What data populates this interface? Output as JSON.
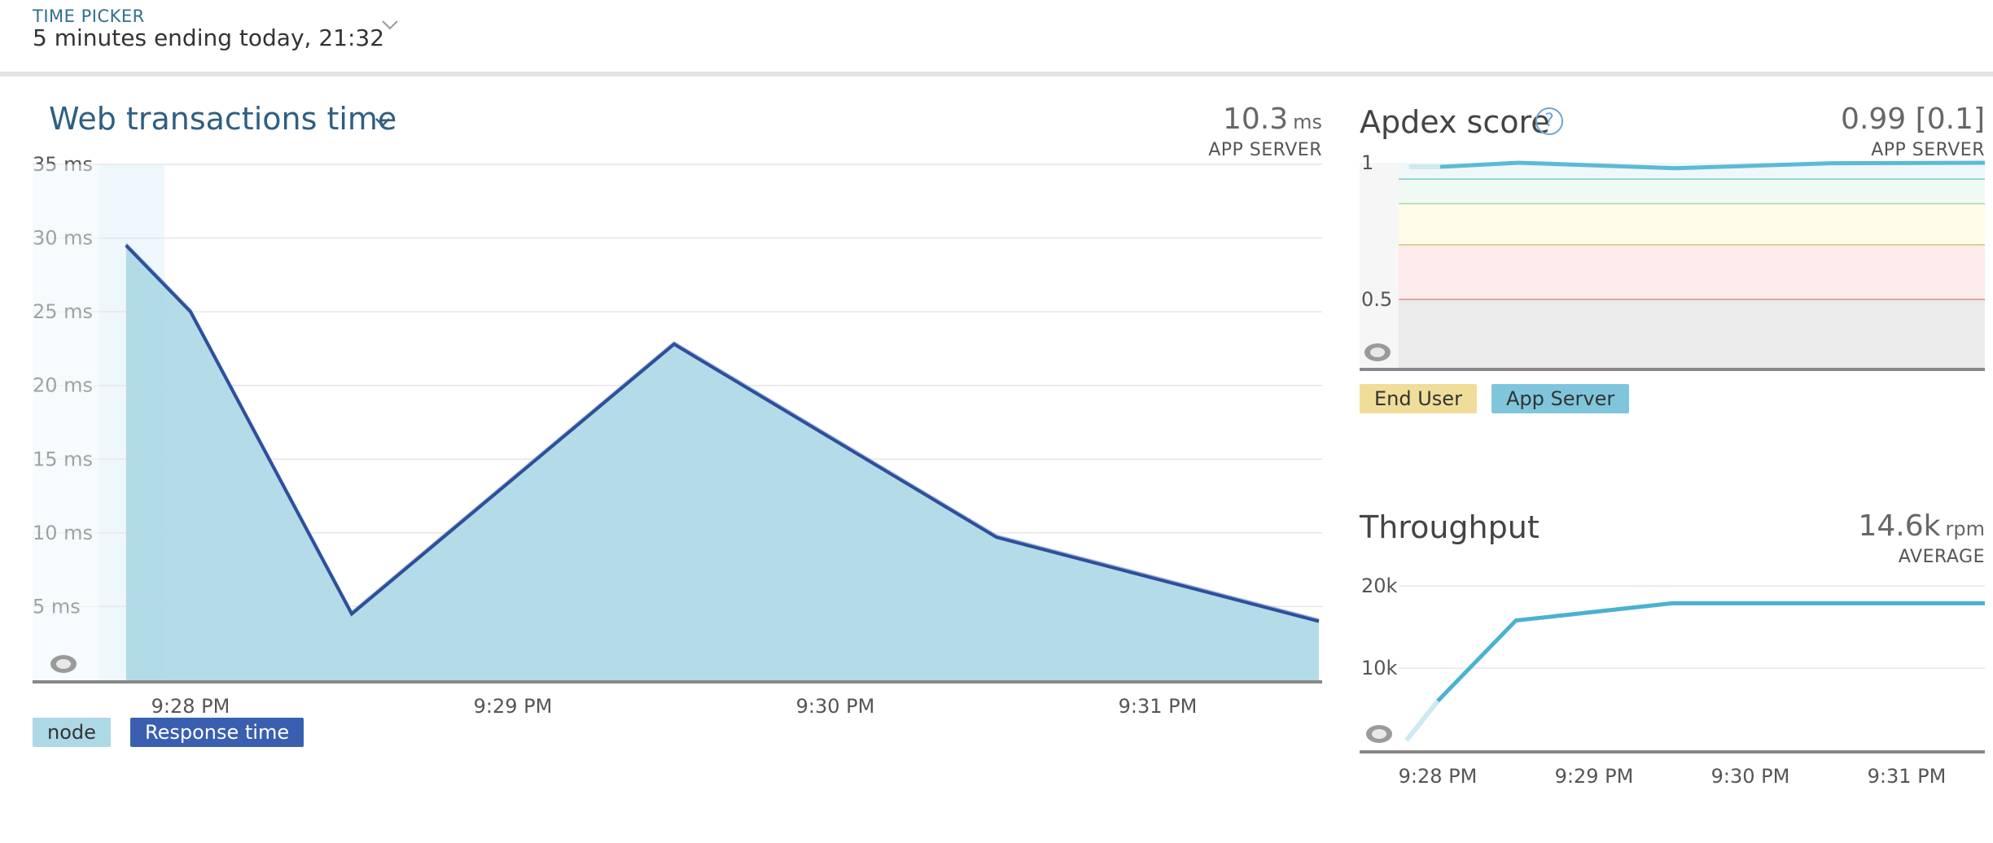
{
  "time_picker": {
    "label": "TIME PICKER",
    "value": "5 minutes ending today, 21:32",
    "icon": "chevron-down-icon"
  },
  "web_panel": {
    "title": "Web transactions time",
    "value": "10.3",
    "unit": "ms",
    "sublabel": "APP SERVER",
    "legend": [
      {
        "label": "node",
        "color": "#add8e6"
      },
      {
        "label": "Response time",
        "color": "#3a5fb0"
      }
    ]
  },
  "apdex_panel": {
    "title": "Apdex score",
    "value": "0.99 [0.1]",
    "sublabel": "APP SERVER",
    "legend": [
      {
        "label": "End User",
        "color": "#f0dd99"
      },
      {
        "label": "App Server",
        "color": "#7fc6dc"
      }
    ]
  },
  "throughput_panel": {
    "title": "Throughput",
    "value": "14.6k",
    "unit": "rpm",
    "sublabel": "AVERAGE"
  },
  "chart_data": [
    {
      "type": "area",
      "title": "Web transactions time",
      "ylim": [
        0,
        35
      ],
      "ytick_labels": [
        "5 ms",
        "10 ms",
        "15 ms",
        "20 ms",
        "25 ms",
        "30 ms",
        "35 ms"
      ],
      "ytick_values": [
        5,
        10,
        15,
        20,
        25,
        30,
        35
      ],
      "xtick_labels": [
        "9:28 PM",
        "9:29 PM",
        "9:30 PM",
        "9:31 PM"
      ],
      "xtick_minutes": [
        0,
        1,
        2,
        3
      ],
      "x_minutes": [
        -0.2,
        0,
        0.5,
        1.5,
        2.5,
        3.5
      ],
      "series": [
        {
          "name": "node",
          "values": [
            29.5,
            25,
            4.5,
            22.8,
            9.7,
            4
          ],
          "color": "#add8e6"
        },
        {
          "name": "Response time",
          "values": [
            29.5,
            25,
            4.5,
            22.8,
            9.7,
            4
          ],
          "color": "#2d4f9c"
        }
      ],
      "grid": true
    },
    {
      "type": "line",
      "title": "Apdex score",
      "ylim": [
        0,
        1
      ],
      "ytick_labels": [
        "0.5",
        "1"
      ],
      "ytick_values": [
        0.5,
        1
      ],
      "x_minutes": [
        -0.2,
        0,
        0.5,
        1.5,
        2.5,
        3.5
      ],
      "series": [
        {
          "name": "App Server",
          "values": [
            0.985,
            0.985,
            1.0,
            0.98,
            0.998,
            1.0
          ],
          "color": "#5bbad5"
        }
      ],
      "bands": [
        {
          "from": 0.5,
          "to": 0.7,
          "color": "#fdeaea"
        },
        {
          "from": 0.7,
          "to": 0.85,
          "color": "#fffbe8"
        },
        {
          "from": 0.85,
          "to": 0.94,
          "color": "#f1faf2"
        },
        {
          "from": 0.94,
          "to": 1.0,
          "color": "#eef8fb"
        }
      ],
      "thresholds": [
        {
          "value": 0.5,
          "color": "#e08a8a"
        },
        {
          "value": 0.7,
          "color": "#d6c67a"
        },
        {
          "value": 0.85,
          "color": "#a8d8a0"
        },
        {
          "value": 0.94,
          "color": "#7fcfc3"
        }
      ]
    },
    {
      "type": "line",
      "title": "Throughput",
      "ylim": [
        0,
        20000
      ],
      "ytick_labels": [
        "10k",
        "20k"
      ],
      "ytick_values": [
        10000,
        20000
      ],
      "xtick_labels": [
        "9:28 PM",
        "9:29 PM",
        "9:30 PM",
        "9:31 PM"
      ],
      "xtick_minutes": [
        0,
        1,
        2,
        3
      ],
      "x_minutes": [
        -0.2,
        0,
        0.5,
        1.5,
        2.5,
        3.5
      ],
      "series": [
        {
          "name": "Throughput",
          "values": [
            1200,
            6000,
            15800,
            17900,
            17900,
            17900
          ],
          "color": "#4bb1d1"
        }
      ],
      "grid": true
    }
  ]
}
